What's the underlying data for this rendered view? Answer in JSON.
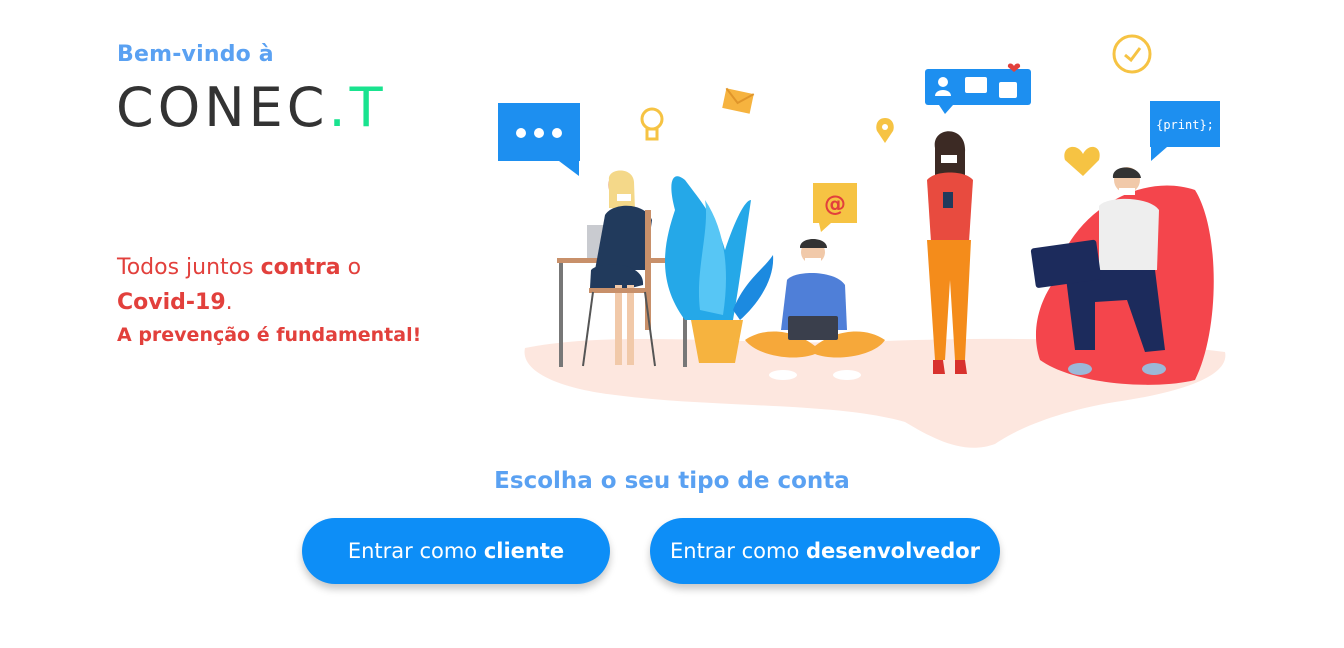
{
  "header": {
    "welcome": "Bem-vindo à",
    "logo_main": "CONEC",
    "logo_accent": ".T"
  },
  "message": {
    "line1_pre": "Todos juntos ",
    "line1_bold": "contra",
    "line1_post": " o",
    "line2_bold": "Covid-19",
    "line2_post": ".",
    "line3": "A prevenção é fundamental!"
  },
  "illustration": {
    "code_bubble": "{print};",
    "at_sign": "@"
  },
  "account": {
    "prompt": "Escolha o seu tipo de conta",
    "client_prefix": "Entrar como ",
    "client_bold": "cliente",
    "dev_prefix": "Entrar como ",
    "dev_bold": "desenvolvedor"
  },
  "colors": {
    "accent_blue": "#5aa1f2",
    "button_blue": "#0d8ef7",
    "covid_red": "#e2403c",
    "logo_green": "#19e38f",
    "logo_dark": "#333333"
  }
}
